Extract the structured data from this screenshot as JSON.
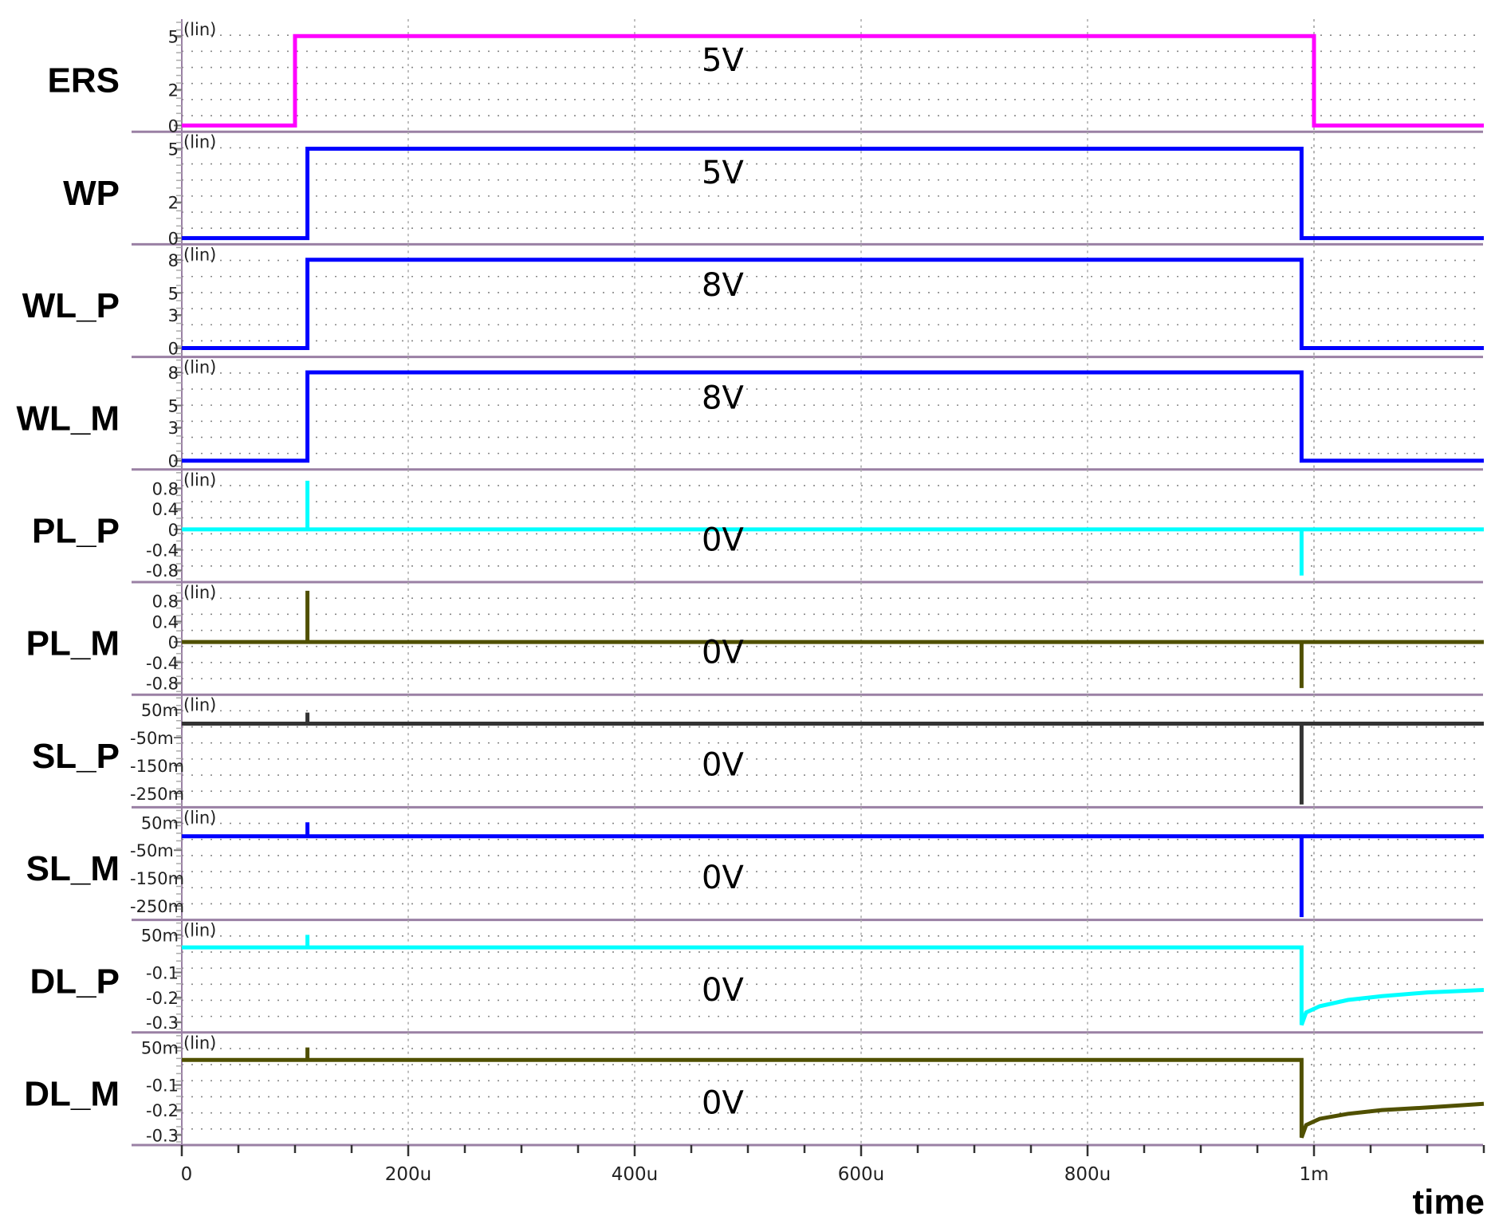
{
  "chart_data": {
    "type": "line",
    "xlabel": "time",
    "x_unit": "us",
    "xlim": [
      0,
      1150
    ],
    "x_ticks": [
      {
        "value": 0,
        "label": "0"
      },
      {
        "value": 200,
        "label": "200u"
      },
      {
        "value": 400,
        "label": "400u"
      },
      {
        "value": 600,
        "label": "600u"
      },
      {
        "value": 800,
        "label": "800u"
      },
      {
        "value": 1000,
        "label": "1m"
      }
    ],
    "x_minor_step": 50,
    "grid": true,
    "scale_label": "(lin)",
    "panels": [
      {
        "name": "ERS",
        "color": "#ff00ff",
        "ylim": [
          -0.35,
          5.95
        ],
        "annotation": "5V",
        "y_ticks": [
          {
            "value": 5,
            "label": "5"
          },
          {
            "value": 2,
            "label": "2"
          },
          {
            "value": 0,
            "label": "0"
          }
        ],
        "points": [
          [
            0,
            0
          ],
          [
            100,
            0
          ],
          [
            100,
            5
          ],
          [
            1000,
            5
          ],
          [
            1000,
            0
          ],
          [
            1150,
            0
          ]
        ]
      },
      {
        "name": "WP",
        "color": "#0000ff",
        "ylim": [
          -0.35,
          5.95
        ],
        "annotation": "5V",
        "y_ticks": [
          {
            "value": 5,
            "label": "5"
          },
          {
            "value": 2,
            "label": "2"
          },
          {
            "value": 0,
            "label": "0"
          }
        ],
        "points": [
          [
            0,
            0
          ],
          [
            111,
            0
          ],
          [
            111,
            5
          ],
          [
            989,
            5
          ],
          [
            989,
            0
          ],
          [
            1150,
            0
          ]
        ]
      },
      {
        "name": "WL_P",
        "color": "#0000ff",
        "ylim": [
          -0.8,
          9.4
        ],
        "annotation": "8V",
        "y_ticks": [
          {
            "value": 8,
            "label": "8"
          },
          {
            "value": 5,
            "label": "5"
          },
          {
            "value": 3,
            "label": "3"
          },
          {
            "value": 0,
            "label": "0"
          }
        ],
        "points": [
          [
            0,
            0
          ],
          [
            111,
            0
          ],
          [
            111,
            8
          ],
          [
            989,
            8
          ],
          [
            989,
            0
          ],
          [
            1150,
            0
          ]
        ]
      },
      {
        "name": "WL_M",
        "color": "#0000ff",
        "ylim": [
          -0.8,
          9.4
        ],
        "annotation": "8V",
        "y_ticks": [
          {
            "value": 8,
            "label": "8"
          },
          {
            "value": 5,
            "label": "5"
          },
          {
            "value": 3,
            "label": "3"
          },
          {
            "value": 0,
            "label": "0"
          }
        ],
        "points": [
          [
            0,
            0
          ],
          [
            111,
            0
          ],
          [
            111,
            8
          ],
          [
            989,
            8
          ],
          [
            989,
            0
          ],
          [
            1150,
            0
          ]
        ]
      },
      {
        "name": "PL_P",
        "color": "#00ffff",
        "ylim": [
          -1.03,
          1.17
        ],
        "annotation": "0V",
        "y_ticks": [
          {
            "value": 0.8,
            "label": "0.8"
          },
          {
            "value": 0.4,
            "label": "0.4"
          },
          {
            "value": 0,
            "label": "0"
          },
          {
            "value": -0.4,
            "label": "-0.4"
          },
          {
            "value": -0.8,
            "label": "-0.8"
          }
        ],
        "points": [
          [
            0,
            0
          ],
          [
            111,
            0
          ],
          [
            111,
            0.95
          ],
          [
            111,
            0
          ],
          [
            989,
            0
          ],
          [
            989,
            -0.9
          ],
          [
            989,
            0
          ],
          [
            1150,
            0
          ]
        ]
      },
      {
        "name": "PL_M",
        "color": "#505000",
        "ylim": [
          -1.03,
          1.17
        ],
        "annotation": "0V",
        "y_ticks": [
          {
            "value": 0.8,
            "label": "0.8"
          },
          {
            "value": 0.4,
            "label": "0.4"
          },
          {
            "value": 0,
            "label": "0"
          },
          {
            "value": -0.4,
            "label": "-0.4"
          },
          {
            "value": -0.8,
            "label": "-0.8"
          }
        ],
        "points": [
          [
            0,
            0
          ],
          [
            111,
            0
          ],
          [
            111,
            1.0
          ],
          [
            111,
            0
          ],
          [
            989,
            0
          ],
          [
            989,
            -0.9
          ],
          [
            989,
            0
          ],
          [
            1150,
            0
          ]
        ]
      },
      {
        "name": "SL_P",
        "color": "#333333",
        "ylim": [
          -0.3,
          0.104
        ],
        "annotation": "0V",
        "y_ticks": [
          {
            "value": 0.05,
            "label": "50m"
          },
          {
            "value": -0.05,
            "label": "-50m"
          },
          {
            "value": -0.15,
            "label": "-150m"
          },
          {
            "value": -0.25,
            "label": "-250m"
          }
        ],
        "points": [
          [
            0,
            0
          ],
          [
            111,
            0
          ],
          [
            111,
            0.04
          ],
          [
            111,
            0
          ],
          [
            989,
            0
          ],
          [
            989,
            -0.29
          ],
          [
            989,
            0
          ],
          [
            1150,
            0
          ]
        ]
      },
      {
        "name": "SL_M",
        "color": "#0000ff",
        "ylim": [
          -0.3,
          0.104
        ],
        "annotation": "0V",
        "y_ticks": [
          {
            "value": 0.05,
            "label": "50m"
          },
          {
            "value": -0.05,
            "label": "-50m"
          },
          {
            "value": -0.15,
            "label": "-150m"
          },
          {
            "value": -0.25,
            "label": "-250m"
          }
        ],
        "points": [
          [
            0,
            0
          ],
          [
            111,
            0
          ],
          [
            111,
            0.05
          ],
          [
            111,
            0
          ],
          [
            989,
            0
          ],
          [
            989,
            -0.29
          ],
          [
            989,
            0
          ],
          [
            1150,
            0
          ]
        ]
      },
      {
        "name": "DL_P",
        "color": "#00ffff",
        "ylim": [
          -0.34,
          0.11
        ],
        "annotation": "0V",
        "y_ticks": [
          {
            "value": 0.05,
            "label": "50m"
          },
          {
            "value": -0.1,
            "label": "-0.1"
          },
          {
            "value": -0.2,
            "label": "-0.2"
          },
          {
            "value": -0.3,
            "label": "-0.3"
          }
        ],
        "points": [
          [
            0,
            0
          ],
          [
            111,
            0
          ],
          [
            111,
            0.05
          ],
          [
            111,
            0
          ],
          [
            989,
            0
          ],
          [
            989,
            -0.31
          ],
          [
            993,
            -0.26
          ],
          [
            1005,
            -0.235
          ],
          [
            1030,
            -0.21
          ],
          [
            1060,
            -0.195
          ],
          [
            1100,
            -0.18
          ],
          [
            1150,
            -0.17
          ]
        ]
      },
      {
        "name": "DL_M",
        "color": "#505000",
        "ylim": [
          -0.34,
          0.11
        ],
        "annotation": "0V",
        "y_ticks": [
          {
            "value": 0.05,
            "label": "50m"
          },
          {
            "value": -0.1,
            "label": "-0.1"
          },
          {
            "value": -0.2,
            "label": "-0.2"
          },
          {
            "value": -0.3,
            "label": "-0.3"
          }
        ],
        "points": [
          [
            0,
            0
          ],
          [
            111,
            0
          ],
          [
            111,
            0.05
          ],
          [
            111,
            0
          ],
          [
            989,
            0
          ],
          [
            989,
            -0.31
          ],
          [
            993,
            -0.26
          ],
          [
            1005,
            -0.235
          ],
          [
            1030,
            -0.215
          ],
          [
            1060,
            -0.2
          ],
          [
            1100,
            -0.19
          ],
          [
            1150,
            -0.175
          ]
        ]
      }
    ]
  }
}
